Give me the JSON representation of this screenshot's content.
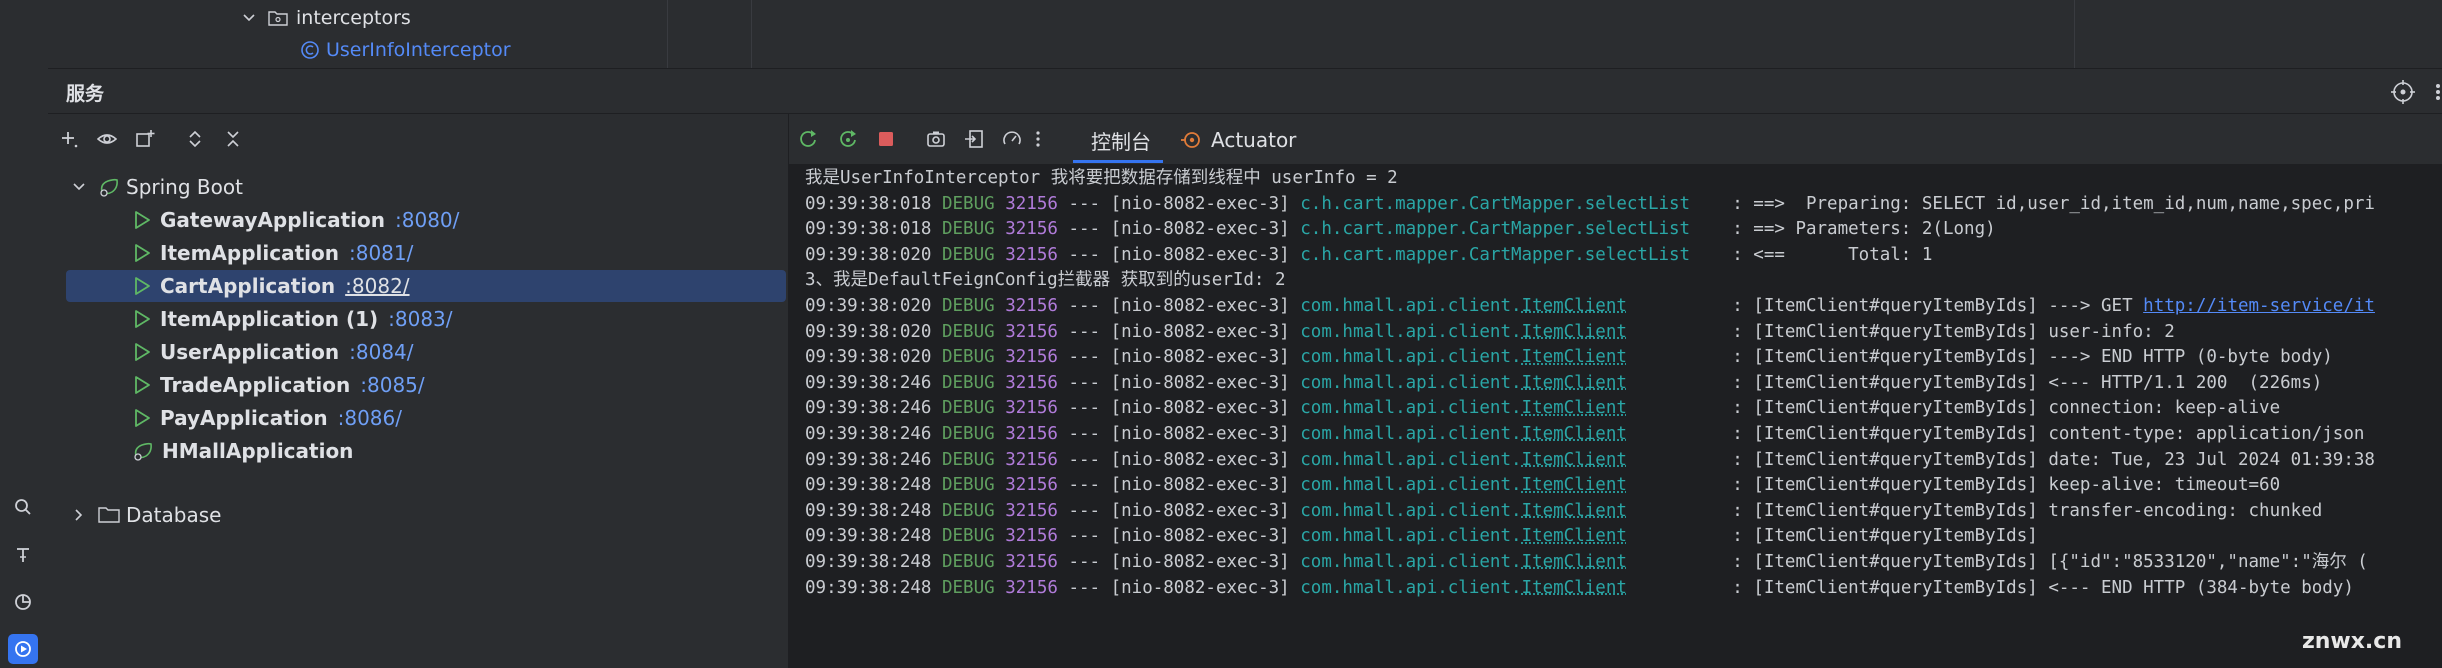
{
  "project_tree": {
    "folder_label": "interceptors",
    "file_label": "UserInfoInterceptor"
  },
  "services": {
    "title": "服务"
  },
  "tree": {
    "root_label": "Spring Boot",
    "apps": [
      {
        "name": "GatewayApplication",
        "port": ":8080/"
      },
      {
        "name": "ItemApplication",
        "port": ":8081/"
      },
      {
        "name": "CartApplication",
        "port": ":8082/"
      },
      {
        "name": "ItemApplication (1)",
        "port": ":8083/"
      },
      {
        "name": "UserApplication",
        "port": ":8084/"
      },
      {
        "name": "TradeApplication",
        "port": ":8085/"
      },
      {
        "name": "PayApplication",
        "port": ":8086/"
      },
      {
        "name": "HMallApplication",
        "port": ""
      }
    ],
    "database_label": "Database"
  },
  "console": {
    "tab_console": "控制台",
    "tab_actuator": "Actuator",
    "lines": [
      {
        "plain": "我是UserInfoInterceptor 我将要把数据存储到线程中 userInfo = 2"
      },
      {
        "ts": "09:39:38:018",
        "lvl": "DEBUG",
        "pid": "32156",
        "thr": "--- [nio-8082-exec-3]",
        "cls": "c.h.cart.mapper.CartMapper.selectList",
        "msg": "    : ==>  Preparing: SELECT id,user_id,item_id,num,name,spec,pri"
      },
      {
        "ts": "09:39:38:018",
        "lvl": "DEBUG",
        "pid": "32156",
        "thr": "--- [nio-8082-exec-3]",
        "cls": "c.h.cart.mapper.CartMapper.selectList",
        "msg": "    : ==> Parameters: 2(Long)"
      },
      {
        "ts": "09:39:38:020",
        "lvl": "DEBUG",
        "pid": "32156",
        "thr": "--- [nio-8082-exec-3]",
        "cls": "c.h.cart.mapper.CartMapper.selectList",
        "msg": "    : <==      Total: 1"
      },
      {
        "plain": "3、我是DefaultFeignConfig拦截器 获取到的userId: 2"
      },
      {
        "ts": "09:39:38:020",
        "lvl": "DEBUG",
        "pid": "32156",
        "thr": "--- [nio-8082-exec-3]",
        "cls_a": "com.hmall.api.client.",
        "cls_b": "ItemClient",
        "msg": "          : [ItemClient#queryItemByIds] ---> GET ",
        "link": "http://item-service/it"
      },
      {
        "ts": "09:39:38:020",
        "lvl": "DEBUG",
        "pid": "32156",
        "thr": "--- [nio-8082-exec-3]",
        "cls_a": "com.hmall.api.client.",
        "cls_b": "ItemClient",
        "msg": "          : [ItemClient#queryItemByIds] user-info: 2"
      },
      {
        "ts": "09:39:38:020",
        "lvl": "DEBUG",
        "pid": "32156",
        "thr": "--- [nio-8082-exec-3]",
        "cls_a": "com.hmall.api.client.",
        "cls_b": "ItemClient",
        "msg": "          : [ItemClient#queryItemByIds] ---> END HTTP (0-byte body)"
      },
      {
        "ts": "09:39:38:246",
        "lvl": "DEBUG",
        "pid": "32156",
        "thr": "--- [nio-8082-exec-3]",
        "cls_a": "com.hmall.api.client.",
        "cls_b": "ItemClient",
        "msg": "          : [ItemClient#queryItemByIds] <--- HTTP/1.1 200  (226ms)"
      },
      {
        "ts": "09:39:38:246",
        "lvl": "DEBUG",
        "pid": "32156",
        "thr": "--- [nio-8082-exec-3]",
        "cls_a": "com.hmall.api.client.",
        "cls_b": "ItemClient",
        "msg": "          : [ItemClient#queryItemByIds] connection: keep-alive"
      },
      {
        "ts": "09:39:38:246",
        "lvl": "DEBUG",
        "pid": "32156",
        "thr": "--- [nio-8082-exec-3]",
        "cls_a": "com.hmall.api.client.",
        "cls_b": "ItemClient",
        "msg": "          : [ItemClient#queryItemByIds] content-type: application/json"
      },
      {
        "ts": "09:39:38:246",
        "lvl": "DEBUG",
        "pid": "32156",
        "thr": "--- [nio-8082-exec-3]",
        "cls_a": "com.hmall.api.client.",
        "cls_b": "ItemClient",
        "msg": "          : [ItemClient#queryItemByIds] date: Tue, 23 Jul 2024 01:39:38"
      },
      {
        "ts": "09:39:38:248",
        "lvl": "DEBUG",
        "pid": "32156",
        "thr": "--- [nio-8082-exec-3]",
        "cls_a": "com.hmall.api.client.",
        "cls_b": "ItemClient",
        "msg": "          : [ItemClient#queryItemByIds] keep-alive: timeout=60"
      },
      {
        "ts": "09:39:38:248",
        "lvl": "DEBUG",
        "pid": "32156",
        "thr": "--- [nio-8082-exec-3]",
        "cls_a": "com.hmall.api.client.",
        "cls_b": "ItemClient",
        "msg": "          : [ItemClient#queryItemByIds] transfer-encoding: chunked"
      },
      {
        "ts": "09:39:38:248",
        "lvl": "DEBUG",
        "pid": "32156",
        "thr": "--- [nio-8082-exec-3]",
        "cls_a": "com.hmall.api.client.",
        "cls_b": "ItemClient",
        "msg": "          : [ItemClient#queryItemByIds]"
      },
      {
        "ts": "09:39:38:248",
        "lvl": "DEBUG",
        "pid": "32156",
        "thr": "--- [nio-8082-exec-3]",
        "cls_a": "com.hmall.api.client.",
        "cls_b": "ItemClient",
        "msg": "          : [ItemClient#queryItemByIds] [{\"id\":\"8533120\",\"name\":\"海尔 ("
      },
      {
        "ts": "09:39:38:248",
        "lvl": "DEBUG",
        "pid": "32156",
        "thr": "--- [nio-8082-exec-3]",
        "cls_a": "com.hmall.api.client.",
        "cls_b": "ItemClient",
        "msg": "          : [ItemClient#queryItemByIds] <--- END HTTP (384-byte body)"
      }
    ]
  },
  "watermark": "znwx.cn",
  "colors": {
    "accent": "#3574f0",
    "selection": "#2e436e",
    "run_green": "#5fb865",
    "stop_red": "#db5c5c",
    "port_blue": "#6f9ff5"
  }
}
